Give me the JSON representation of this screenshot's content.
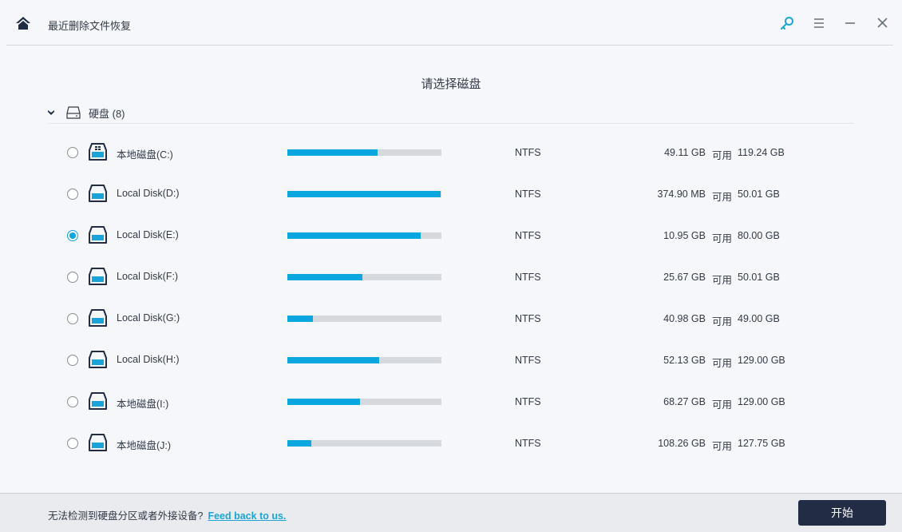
{
  "window": {
    "title": "最近删除文件恢复",
    "icons": {
      "home": "home-icon",
      "key": "key-icon",
      "menu": "hamburger-menu-icon",
      "minimize": "minimize-icon",
      "close": "close-icon"
    },
    "accent_color": "#0aa6df",
    "dark_color": "#222d45"
  },
  "main": {
    "title": "请选择磁盘",
    "group": {
      "label": "硬盘 (8)",
      "expanded": true,
      "drives": [
        {
          "name": "本地磁盘(C:)",
          "type": "system",
          "selected": false,
          "used_fraction": 0.588,
          "fs": "NTFS",
          "free": "49.11 GB",
          "free_label": "可用",
          "total": "119.24 GB"
        },
        {
          "name": "Local Disk(D:)",
          "type": "disk",
          "selected": false,
          "used_fraction": 0.993,
          "fs": "NTFS",
          "free": "374.90 MB",
          "free_label": "可用",
          "total": "50.01 GB"
        },
        {
          "name": "Local Disk(E:)",
          "type": "disk",
          "selected": true,
          "used_fraction": 0.863,
          "fs": "NTFS",
          "free": "10.95 GB",
          "free_label": "可用",
          "total": "80.00 GB"
        },
        {
          "name": "Local Disk(F:)",
          "type": "disk",
          "selected": false,
          "used_fraction": 0.487,
          "fs": "NTFS",
          "free": "25.67 GB",
          "free_label": "可用",
          "total": "50.01 GB"
        },
        {
          "name": "Local Disk(G:)",
          "type": "disk",
          "selected": false,
          "used_fraction": 0.164,
          "fs": "NTFS",
          "free": "40.98 GB",
          "free_label": "可用",
          "total": "49.00 GB"
        },
        {
          "name": "Local Disk(H:)",
          "type": "disk",
          "selected": false,
          "used_fraction": 0.596,
          "fs": "NTFS",
          "free": "52.13 GB",
          "free_label": "可用",
          "total": "129.00 GB"
        },
        {
          "name": "本地磁盘(I:)",
          "type": "disk",
          "selected": false,
          "used_fraction": 0.471,
          "fs": "NTFS",
          "free": "68.27 GB",
          "free_label": "可用",
          "total": "129.00 GB"
        },
        {
          "name": "本地磁盘(J:)",
          "type": "disk",
          "selected": false,
          "used_fraction": 0.153,
          "fs": "NTFS",
          "free": "108.26 GB",
          "free_label": "可用",
          "total": "127.75 GB"
        }
      ]
    }
  },
  "footer": {
    "message": "无法检测到硬盘分区或者外接设备?",
    "feedback_link": "Feed back to us.",
    "start_button": "开始"
  }
}
